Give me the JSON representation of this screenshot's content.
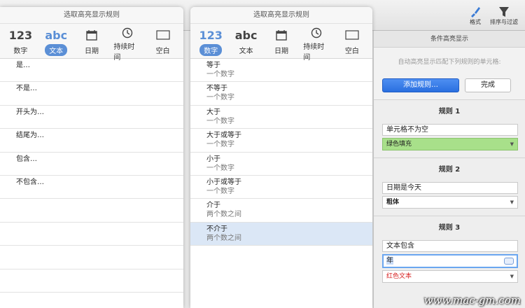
{
  "panel1": {
    "title": "选取高亮显示规则",
    "tabs": [
      {
        "glyph": "123",
        "label": "数字"
      },
      {
        "glyph": "abc",
        "label": "文本"
      },
      {
        "glyph": "",
        "label": "日期"
      },
      {
        "glyph": "",
        "label": "持续时间"
      },
      {
        "glyph": "",
        "label": "空白"
      }
    ],
    "active_tab": 1,
    "rows": [
      "是…",
      "不是…",
      "开头为…",
      "结尾为…",
      "包含…",
      "不包含…"
    ]
  },
  "panel2": {
    "title": "选取高亮显示规则",
    "tabs": [
      {
        "glyph": "123",
        "label": "数字"
      },
      {
        "glyph": "abc",
        "label": "文本"
      },
      {
        "glyph": "",
        "label": "日期"
      },
      {
        "glyph": "",
        "label": "持续时间"
      },
      {
        "glyph": "",
        "label": "空白"
      }
    ],
    "active_tab": 0,
    "rows": [
      {
        "main": "等于",
        "sub": "一个数字"
      },
      {
        "main": "不等于",
        "sub": "一个数字"
      },
      {
        "main": "大于",
        "sub": "一个数字"
      },
      {
        "main": "大于或等于",
        "sub": "一个数字"
      },
      {
        "main": "小于",
        "sub": "一个数字"
      },
      {
        "main": "小于或等于",
        "sub": "一个数字"
      },
      {
        "main": "介于",
        "sub": "两个数之间"
      },
      {
        "main": "不介于",
        "sub": "两个数之间"
      }
    ],
    "selected_row": 7
  },
  "toolbar": {
    "format_label": "格式",
    "sort_label": "排序与过滤",
    "format_icon": "paintbrush-icon",
    "sort_icon": "funnel-icon"
  },
  "sidebar": {
    "title": "条件高亮显示",
    "description": "自动高亮显示匹配下列规则的单元格:",
    "add_rule_label": "添加规则…",
    "done_label": "完成",
    "rules": [
      {
        "heading": "规则 1",
        "condition": "单元格不为空",
        "style": "绿色填充"
      },
      {
        "heading": "规则 2",
        "condition": "日期是今天",
        "style": "粗体"
      },
      {
        "heading": "规则 3",
        "condition": "文本包含",
        "value": "年",
        "style": "红色文本"
      }
    ]
  },
  "colors": {
    "accent": "#5b8fd6",
    "primary_button": "#2a6fe0",
    "green_fill": "#a8e08a",
    "red_text": "#d62020",
    "selected_row": "#dbe7f6"
  },
  "watermark": "www.mac-gm.com"
}
